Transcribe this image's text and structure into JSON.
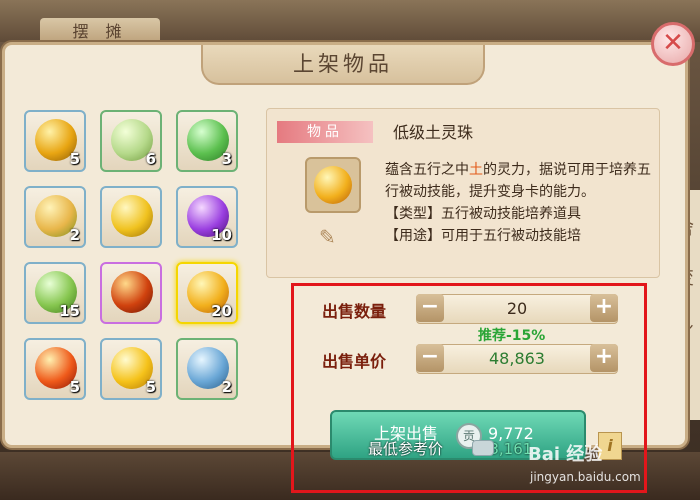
{
  "background": {
    "tab_label": "摆 摊",
    "side_text": [
      "舍",
      "变",
      "身"
    ]
  },
  "dialog": {
    "title": "上架物品",
    "close_glyph": "✕"
  },
  "inventory": [
    {
      "count": "5",
      "border": "blue",
      "colors": [
        "#fff2a8",
        "#e8a512",
        "#8a5a07"
      ]
    },
    {
      "count": "6",
      "border": "green",
      "colors": [
        "#f3ffd8",
        "#b5d98a",
        "#6f9a3c"
      ]
    },
    {
      "count": "3",
      "border": "green",
      "colors": [
        "#d7ffd0",
        "#5cc04f",
        "#2c7a26"
      ]
    },
    {
      "count": "2",
      "border": "blue",
      "colors": [
        "#fff3b8",
        "#e8b64a",
        "#7a8f1c"
      ]
    },
    {
      "count": "",
      "border": "blue",
      "colors": [
        "#fff7c0",
        "#f0c21f",
        "#9a6d05"
      ]
    },
    {
      "count": "10",
      "border": "blue",
      "colors": [
        "#f5d8ff",
        "#9a3fe0",
        "#4b1075"
      ]
    },
    {
      "count": "15",
      "border": "blue",
      "colors": [
        "#e8ffd6",
        "#86c64f",
        "#3f7a1c"
      ]
    },
    {
      "count": "",
      "border": "purple",
      "colors": [
        "#ffd98a",
        "#d0420e",
        "#6a1505"
      ]
    },
    {
      "count": "20",
      "border": "selected",
      "colors": [
        "#fff7b8",
        "#f2b01d",
        "#b85d06"
      ]
    },
    {
      "count": "5",
      "border": "blue",
      "colors": [
        "#fff0b0",
        "#ef5a1a",
        "#8a1505"
      ]
    },
    {
      "count": "5",
      "border": "blue",
      "colors": [
        "#fffbd0",
        "#f5c21a",
        "#b57a05"
      ]
    },
    {
      "count": "2",
      "border": "green",
      "colors": [
        "#e7f6ff",
        "#6aa7d6",
        "#2a5f8a"
      ]
    }
  ],
  "item": {
    "tag": "物品",
    "name": "低级土灵珠",
    "desc_pre": "蕴含五行之中",
    "desc_hl": "土",
    "desc_post": "的灵力，据说可用于培养五行被动技能，提升变身卡的能力。",
    "type_line": "【类型】五行被动技能培养道具",
    "use_line": "【用途】可用于五行被动技能培"
  },
  "sale": {
    "qty_label": "出售数量",
    "qty_value": "20",
    "recommend": "推荐-15%",
    "price_label": "出售单价",
    "price_value": "48,863",
    "sell_label": "上架出售",
    "coin_glyph": "贡",
    "sell_amount": "9,772",
    "info_glyph": "i"
  },
  "reference": {
    "label": "最低参考价",
    "value": "43,161"
  },
  "watermark": {
    "line1": "Bai 经验",
    "line2": "jingyan.baidu.com"
  }
}
